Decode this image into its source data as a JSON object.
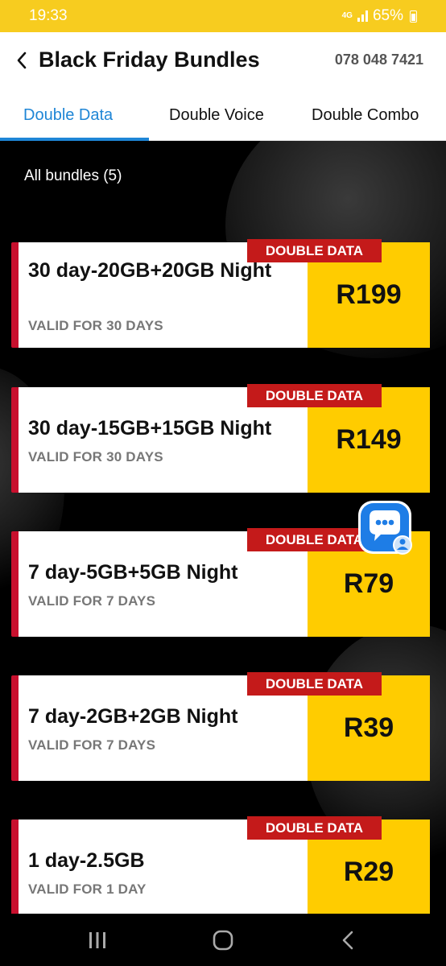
{
  "status_bar": {
    "time": "19:33",
    "network": "4G",
    "battery": "65%"
  },
  "header": {
    "title": "Black Friday Bundles",
    "phone": "078 048 7421"
  },
  "tabs": [
    {
      "label": "Double Data",
      "active": true
    },
    {
      "label": "Double Voice",
      "active": false
    },
    {
      "label": "Double Combo",
      "active": false
    }
  ],
  "list": {
    "title": "All bundles (5)",
    "bundles": [
      {
        "badge": "DOUBLE DATA",
        "name": "30 day-20GB+20GB Night",
        "validity": "VALID FOR 30 DAYS",
        "price": "R199"
      },
      {
        "badge": "DOUBLE DATA",
        "name": "30 day-15GB+15GB Night",
        "validity": "VALID FOR 30 DAYS",
        "price": "R149"
      },
      {
        "badge": "DOUBLE DATA",
        "name": "7 day-5GB+5GB Night",
        "validity": "VALID FOR 7 DAYS",
        "price": "R79"
      },
      {
        "badge": "DOUBLE DATA",
        "name": "7 day-2GB+2GB Night",
        "validity": "VALID FOR 7 DAYS",
        "price": "R39"
      },
      {
        "badge": "DOUBLE DATA",
        "name": "1 day-2.5GB",
        "validity": "VALID FOR 1 DAY",
        "price": "R29"
      }
    ]
  },
  "colors": {
    "brand_yellow": "#ffcc00",
    "accent_red": "#c8102e",
    "tab_blue": "#1f86d6",
    "background": "#000000"
  },
  "icons": {
    "back": "chevron-left-icon",
    "chat": "chat-bubble-icon",
    "nav_recents": "recents-icon",
    "nav_home": "home-icon",
    "nav_back": "back-icon"
  }
}
